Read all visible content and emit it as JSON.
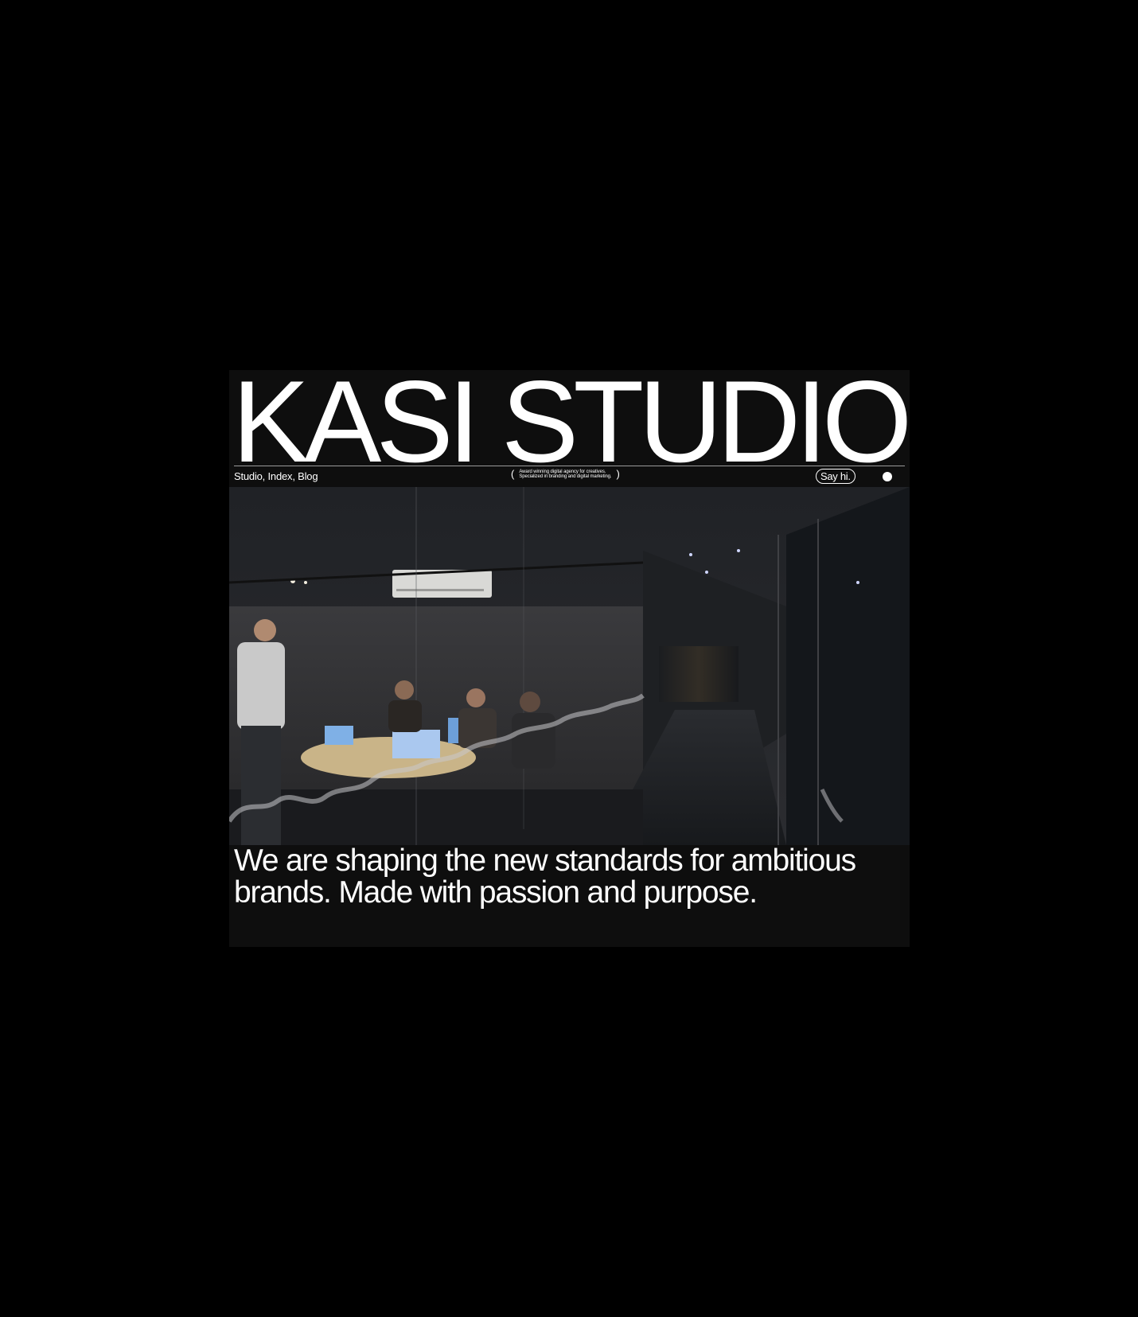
{
  "brand": {
    "title": "KASI STUDIO"
  },
  "nav": {
    "links": [
      "Studio",
      "Index",
      "Blog"
    ],
    "separator": ", "
  },
  "tagline": {
    "open_paren": "(",
    "line1": "Award winning digital agency for creatives.",
    "line2": "Specialized in branding and digital marketing.",
    "close_paren": ")"
  },
  "cta": {
    "say_hi": "Say hi."
  },
  "hero_image": {
    "description_icon": "office-meeting-photo"
  },
  "statement": {
    "text": "We are shaping the new standards for ambitious brands. Made with passion and purpose."
  },
  "colors": {
    "page_bg": "#000000",
    "frame_bg": "#0e0e0e",
    "text": "#ffffff"
  }
}
